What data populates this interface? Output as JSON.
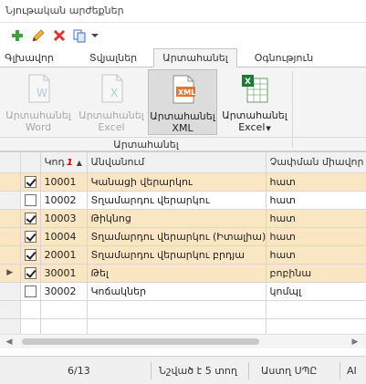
{
  "window": {
    "title": "Նյութական արժեքներ"
  },
  "toolbar": {
    "add_icon": "plus-icon",
    "edit_icon": "pencil-icon",
    "delete_icon": "x-icon",
    "copy_icon": "copy-icon",
    "more_icon": "dropdown-arrow-icon"
  },
  "tabs": [
    {
      "label": "Գլխավոր"
    },
    {
      "label": "Տվյալներ"
    },
    {
      "label": "Արտահանել",
      "active": true
    },
    {
      "label": "Օգնություն"
    }
  ],
  "ribbon": {
    "group_label": "Արտահանել",
    "buttons": [
      {
        "label1": "Արտահանել",
        "label2": "Word",
        "icon": "word-doc-icon",
        "enabled": false
      },
      {
        "label1": "Արտահանել",
        "label2": "Excel",
        "icon": "excel-doc-icon",
        "enabled": false
      },
      {
        "label1": "Արտահանել",
        "label2": "XML",
        "icon": "xml-doc-icon",
        "enabled": true,
        "pressed": true
      },
      {
        "label1": "Արտահանել",
        "label2": "Excel",
        "icon": "excel-sheet-icon",
        "enabled": true,
        "dropdown": true
      }
    ]
  },
  "grid": {
    "columns": [
      {
        "label": "Կոդ",
        "sort_index": "1",
        "sort": "asc"
      },
      {
        "label": "Անվանում"
      },
      {
        "label": "Չափման միավոր"
      }
    ],
    "rows": [
      {
        "checked": true,
        "code": "10001",
        "name": "Կանացի վերարկու",
        "unit": "հատ",
        "selected": true
      },
      {
        "checked": false,
        "code": "10002",
        "name": "Տղամարդու վերարկու",
        "unit": "հատ",
        "selected": false
      },
      {
        "checked": true,
        "code": "10003",
        "name": "Թիկնոց",
        "unit": "հատ",
        "selected": true
      },
      {
        "checked": true,
        "code": "10004",
        "name": "Տղամարդու վերարկու (Իտալիա)",
        "unit": "հատ",
        "selected": true
      },
      {
        "checked": true,
        "code": "20001",
        "name": "Տղամարդու վերարկու բրդյա",
        "unit": "հատ",
        "selected": true
      },
      {
        "checked": true,
        "code": "30001",
        "name": "Թել",
        "unit": "բոբինա",
        "selected": true,
        "current": true
      },
      {
        "checked": false,
        "code": "30002",
        "name": "Կոճակներ",
        "unit": "կոմպլ",
        "selected": false
      }
    ]
  },
  "status": {
    "position": "6/13",
    "selected": "Նշված է 5 տող",
    "org": "Աստղ ՍՊԸ",
    "extra": "AI"
  }
}
